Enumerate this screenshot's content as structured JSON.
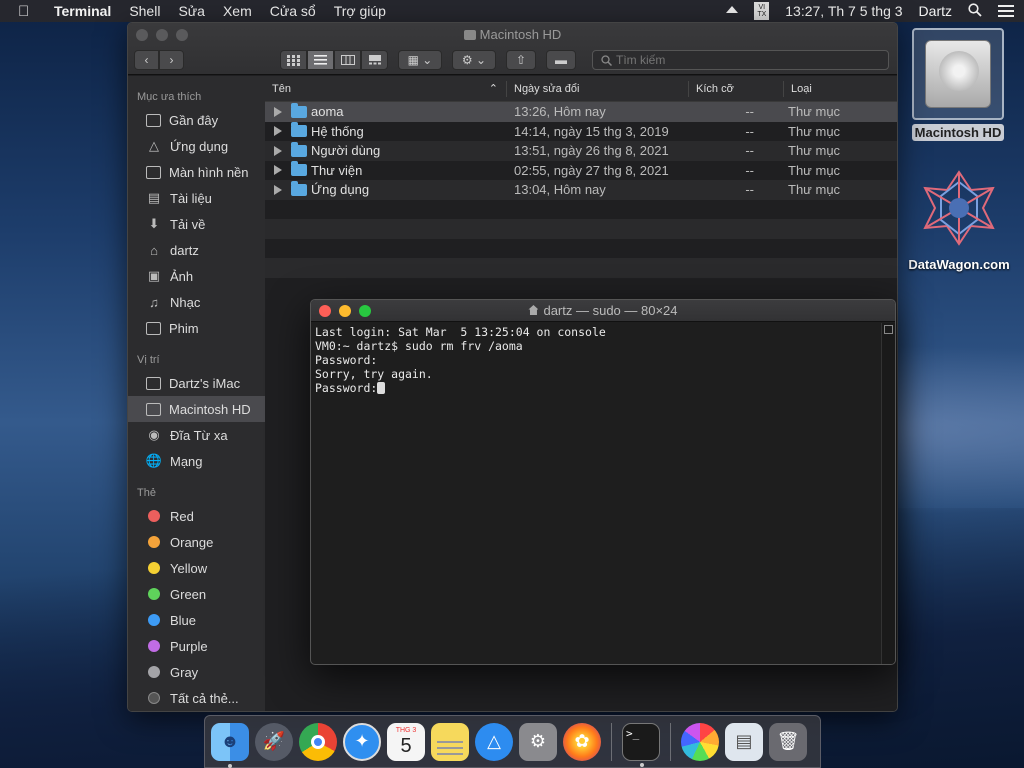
{
  "menubar": {
    "app_name": "Terminal",
    "items": [
      "Shell",
      "Sửa",
      "Xem",
      "Cửa sổ",
      "Trợ giúp"
    ],
    "input_badge": "VI\nTX",
    "clock": "13:27, Th 7 5 thg 3",
    "user": "Dartz"
  },
  "desktop": {
    "hd_label": "Macintosh HD",
    "datawagon_label": "DataWagon.com"
  },
  "finder": {
    "title": "Macintosh HD",
    "search_placeholder": "Tìm kiếm",
    "sidebar": {
      "favorites_header": "Mục ưa thích",
      "favorites": [
        {
          "label": "Gần đây",
          "icon": "recents-icon"
        },
        {
          "label": "Ứng dụng",
          "icon": "applications-icon"
        },
        {
          "label": "Màn hình nền",
          "icon": "desktop-icon"
        },
        {
          "label": "Tài liệu",
          "icon": "documents-icon"
        },
        {
          "label": "Tải về",
          "icon": "downloads-icon"
        },
        {
          "label": "dartz",
          "icon": "home-icon"
        },
        {
          "label": "Ảnh",
          "icon": "pictures-icon"
        },
        {
          "label": "Nhạc",
          "icon": "music-icon"
        },
        {
          "label": "Phim",
          "icon": "movies-icon"
        }
      ],
      "locations_header": "Vị trí",
      "locations": [
        {
          "label": "Dartz's iMac",
          "icon": "imac-icon"
        },
        {
          "label": "Macintosh HD",
          "icon": "hard-drive-icon",
          "selected": true
        },
        {
          "label": "Đĩa Từ xa",
          "icon": "remote-disc-icon"
        },
        {
          "label": "Mạng",
          "icon": "network-icon"
        }
      ],
      "tags_header": "Thẻ",
      "tags": [
        {
          "label": "Red",
          "color": "#ec5f5d"
        },
        {
          "label": "Orange",
          "color": "#f4a33a"
        },
        {
          "label": "Yellow",
          "color": "#f5d033"
        },
        {
          "label": "Green",
          "color": "#5fd35b"
        },
        {
          "label": "Blue",
          "color": "#3d9bf5"
        },
        {
          "label": "Purple",
          "color": "#c16ce5"
        },
        {
          "label": "Gray",
          "color": "#a4a4a8"
        }
      ],
      "all_tags": "Tất cả thẻ..."
    },
    "columns": {
      "name": "Tên",
      "date": "Ngày sửa đổi",
      "size": "Kích cỡ",
      "kind": "Loại"
    },
    "rows": [
      {
        "name": "aoma",
        "date": "13:26, Hôm nay",
        "size": "--",
        "kind": "Thư mục",
        "selected": true
      },
      {
        "name": "Hệ thống",
        "date": "14:14, ngày 15 thg 3, 2019",
        "size": "--",
        "kind": "Thư mục"
      },
      {
        "name": "Người dùng",
        "date": "13:51, ngày 26 thg 8, 2021",
        "size": "--",
        "kind": "Thư mục"
      },
      {
        "name": "Thư viện",
        "date": "02:55, ngày 27 thg 8, 2021",
        "size": "--",
        "kind": "Thư mục"
      },
      {
        "name": "Ứng dụng",
        "date": "13:04, Hôm nay",
        "size": "--",
        "kind": "Thư mục"
      }
    ]
  },
  "terminal": {
    "title": "dartz — sudo — 80×24",
    "lines": [
      "Last login: Sat Mar  5 13:25:04 on console",
      "VM0:~ dartz$ sudo rm frv /aoma",
      "Password:",
      "Sorry, try again.",
      "Password:"
    ]
  },
  "dock": {
    "apps": [
      {
        "name": "finder-app",
        "color": "#3b8ee6",
        "running": true
      },
      {
        "name": "launchpad-app",
        "color": "#555a66",
        "running": false
      },
      {
        "name": "chrome-app",
        "color": "#e9e9e9",
        "running": false
      },
      {
        "name": "safari-app",
        "color": "#2f8ff0",
        "running": false
      },
      {
        "name": "calendar-app",
        "color": "#f5f5f5",
        "running": false,
        "month": "THG 3",
        "day": "5"
      },
      {
        "name": "notes-app",
        "color": "#f6d95c",
        "running": false
      },
      {
        "name": "app-store-app",
        "color": "#2d8cf0",
        "running": false
      },
      {
        "name": "system-preferences-app",
        "color": "#8a8a8e",
        "running": false
      },
      {
        "name": "firefox-app",
        "color": "#ff7a1a",
        "running": false
      },
      {
        "name": "terminal-app",
        "color": "#1a1a1a",
        "running": true,
        "glyph": ">_"
      },
      {
        "name": "photos-app",
        "color": "#f0f0f0",
        "running": false
      },
      {
        "name": "preview-app",
        "color": "#dfe6ee",
        "running": false
      },
      {
        "name": "trash-app",
        "color": "#6a6a70",
        "running": false
      }
    ]
  }
}
